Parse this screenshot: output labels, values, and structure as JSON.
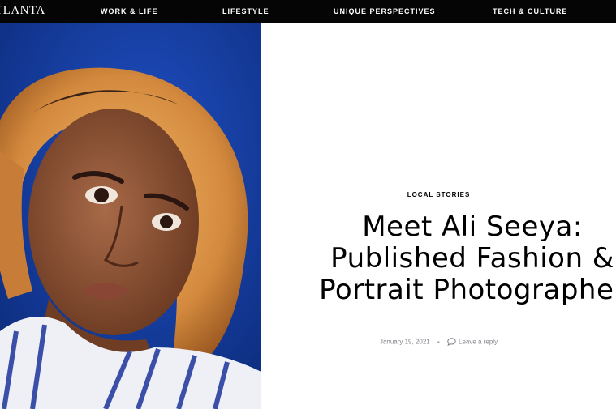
{
  "nav": {
    "logo": "TLANTA",
    "items": [
      "WORK & LIFE",
      "LIFESTYLE",
      "UNIQUE PERSPECTIVES",
      "TECH & CULTURE"
    ]
  },
  "article": {
    "category": "LOCAL STORIES",
    "title_lines": [
      "Meet Ali Seeya:",
      "Published Fashion &",
      "Portrait Photographer"
    ],
    "date": "January 19, 2021",
    "separator": "•",
    "reply_label": "Leave a reply"
  },
  "colors": {
    "nav_bg": "#050505",
    "hero_bg": "#133c9a",
    "text": "#000000",
    "meta": "#7f8288"
  },
  "icons": {
    "reply": "speech-bubble-icon"
  }
}
